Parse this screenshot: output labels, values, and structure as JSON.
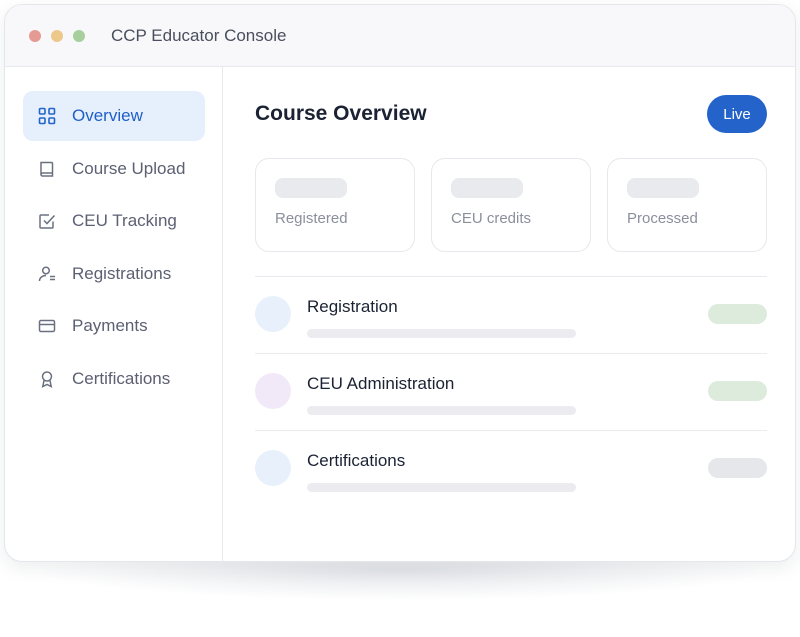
{
  "window": {
    "title": "CCP Educator Console"
  },
  "sidebar": {
    "items": [
      {
        "label": "Overview",
        "icon": "grid-icon",
        "active": true
      },
      {
        "label": "Course Upload",
        "icon": "book-icon",
        "active": false
      },
      {
        "label": "CEU Tracking",
        "icon": "checkbox-icon",
        "active": false
      },
      {
        "label": "Registrations",
        "icon": "user-icon",
        "active": false
      },
      {
        "label": "Payments",
        "icon": "card-icon",
        "active": false
      },
      {
        "label": "Certifications",
        "icon": "award-icon",
        "active": false
      }
    ]
  },
  "main": {
    "title": "Course Overview",
    "live_label": "Live",
    "stats": [
      {
        "label": "Registered"
      },
      {
        "label": "CEU credits"
      },
      {
        "label": "Processed"
      }
    ],
    "rows": [
      {
        "title": "Registration",
        "avatar_color": "#e8f0fc",
        "status_color": "#dcebdc"
      },
      {
        "title": "CEU Administration",
        "avatar_color": "#f1e9f8",
        "status_color": "#dcebdc"
      },
      {
        "title": "Certifications",
        "avatar_color": "#e8f0fc",
        "status_color": "#e6e7eb"
      }
    ]
  },
  "colors": {
    "accent": "#2463c9",
    "active_bg": "#e6effc"
  }
}
